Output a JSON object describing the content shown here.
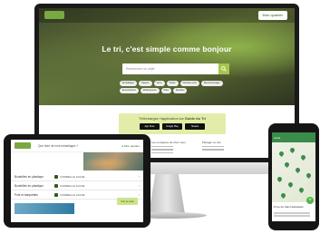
{
  "desktop": {
    "hero_title": "Le tri, c'est simple comme bonjour",
    "nav_button": "Mon quartier",
    "search_placeholder": "Rechercher un objet",
    "chips": [
      "Emballages",
      "Papiers",
      "Verre",
      "Textile",
      "Déchets verts",
      "Électroménager",
      "Encombrants",
      "Médicaments",
      "Piles",
      "Meubles"
    ],
    "banner_text_prefix": "Téléchargez l'application",
    "banner_text_bold": "Le Guide du Tri",
    "store_badges": [
      "App Store",
      "Google Play",
      "Huawei"
    ],
    "footer_columns": [
      "Les consignes de chez vous",
      "Partager ce site"
    ]
  },
  "tablet": {
    "title": "Que faire de mes emballages ?",
    "city_label": "Mon quartier",
    "rows": [
      {
        "label": "Bouteilles en plastique",
        "value": "CORBEILLE JAUNE"
      },
      {
        "label": "Bouteilles en plastique",
        "value": "CORBEILLE JAUNE"
      },
      {
        "label": "Pots et barquettes",
        "value": "CORBEILLE JAUNE"
      },
      {
        "label": "Films et sacs plastique",
        "value": "CORBEILLE JAUNE"
      }
    ],
    "cta_button": "Voir la carte"
  },
  "phone": {
    "header_label": "Carte",
    "address": "8 rue de Saint-Sebastien",
    "fab_label": "+"
  },
  "colors": {
    "brand_green": "#3a8c4a",
    "accent_lime": "#a6c54a",
    "banner_bg": "#e4ecaa",
    "device_frame": "#151515"
  }
}
